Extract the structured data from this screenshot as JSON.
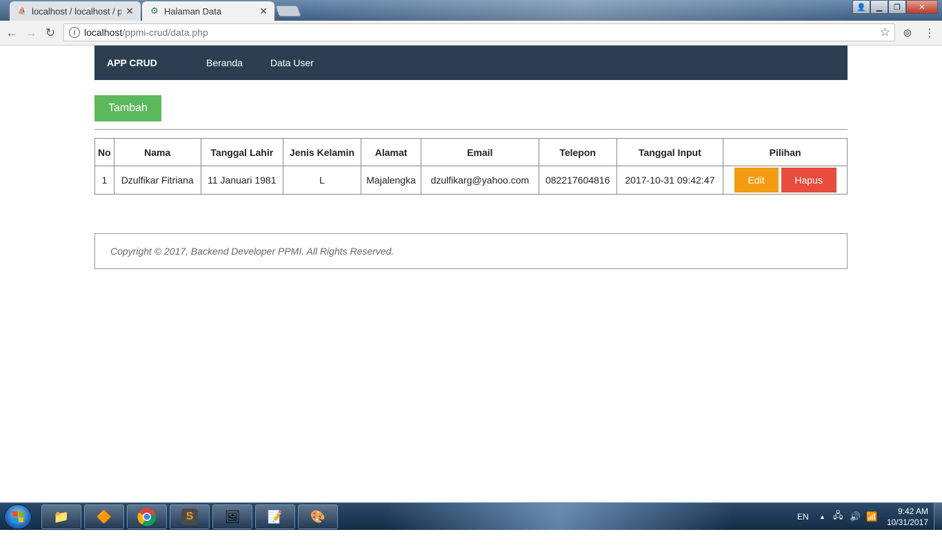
{
  "browser": {
    "tabs": [
      {
        "label": "localhost / localhost / pp",
        "favicon": "pma"
      },
      {
        "label": "Halaman Data",
        "favicon": "gear"
      }
    ],
    "url_host": "localhost",
    "url_path": "/ppmi-crud/data.php"
  },
  "navbar": {
    "brand": "APP CRUD",
    "links": [
      "Beranda",
      "Data User"
    ]
  },
  "actions": {
    "add_label": "Tambah"
  },
  "table": {
    "headers": [
      "No",
      "Nama",
      "Tanggal Lahir",
      "Jenis Kelamin",
      "Alamat",
      "Email",
      "Telepon",
      "Tanggal Input",
      "Pilihan"
    ],
    "rows": [
      {
        "no": "1",
        "nama": "Dzulfikar Fitriana",
        "tanggal_lahir": "11 Januari 1981",
        "jenis_kelamin": "L",
        "alamat": "Majalengka",
        "email": "dzulfikarg@yahoo.com",
        "telepon": "082217604816",
        "tanggal_input": "2017-10-31 09:42:47",
        "edit_label": "Edit",
        "hapus_label": "Hapus"
      }
    ]
  },
  "footer": {
    "text": "Copyright © 2017, Backend Developer PPMI. All Rights Reserved."
  },
  "taskbar": {
    "language": "EN",
    "time": "9:42 AM",
    "date": "10/31/2017"
  },
  "colors": {
    "navbar": "#2c3e50",
    "tambah": "#5cb85c",
    "edit": "#f39c12",
    "hapus": "#e74c3c"
  }
}
